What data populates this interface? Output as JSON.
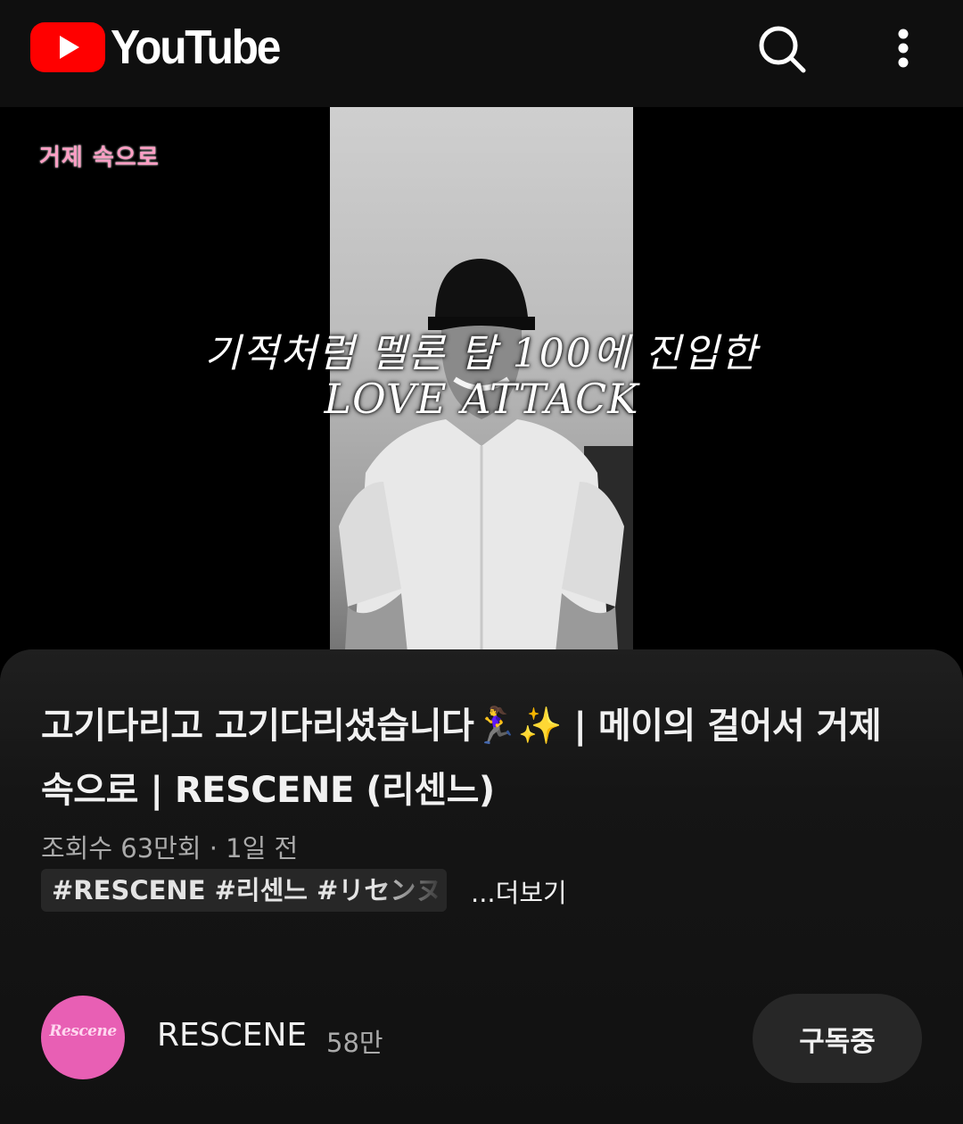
{
  "header": {
    "logo_text": "YouTube",
    "brand_color": "#ff0000",
    "icons": [
      "youtube-play-icon",
      "search-icon",
      "more-vert-icon"
    ]
  },
  "video": {
    "overlay_logo": "거제 속으로",
    "caption_line1": "기적처럼 멜론 탑 100에 진입한",
    "caption_line2": "LOVE ATTACK"
  },
  "details": {
    "title": "고기다리고 고기다리셨습니다🏃‍♀️✨ | 메이의 걸어서 거제 속으로 | RESCENE (리센느)",
    "meta": "조회수 63만회 · 1일 전",
    "tags": "#RESCENE #리센느 #リセンヌ",
    "more_label": "...더보기"
  },
  "channel": {
    "avatar_text": "Rescene",
    "avatar_color": "#e85fb4",
    "name": "RESCENE",
    "subscribers": "58만",
    "subscribe_label": "구독중"
  }
}
